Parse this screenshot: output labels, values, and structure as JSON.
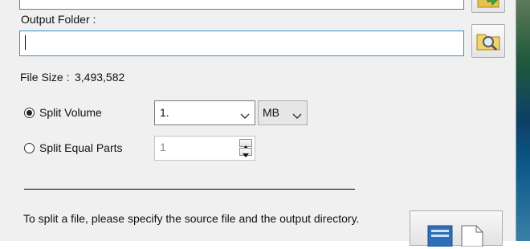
{
  "source_folder": {
    "value": ""
  },
  "output_folder": {
    "label": "Output Folder :",
    "value": ""
  },
  "file_size": {
    "label": "File Size :",
    "value": "3,493,582"
  },
  "split_volume": {
    "label": "Split Volume",
    "selected": true,
    "value": "1.",
    "unit": "MB"
  },
  "split_equal_parts": {
    "label": "Split Equal Parts",
    "selected": false,
    "value": "1"
  },
  "help_text": "To split a file, please specify the source file and the output directory.",
  "icons": {
    "source_browse": "folder-arrow-icon",
    "output_browse": "folder-search-icon",
    "split_action": "split-file-icon"
  },
  "colors": {
    "focus_border": "#3c8ecb",
    "window_bg": "#f0f0f0"
  }
}
